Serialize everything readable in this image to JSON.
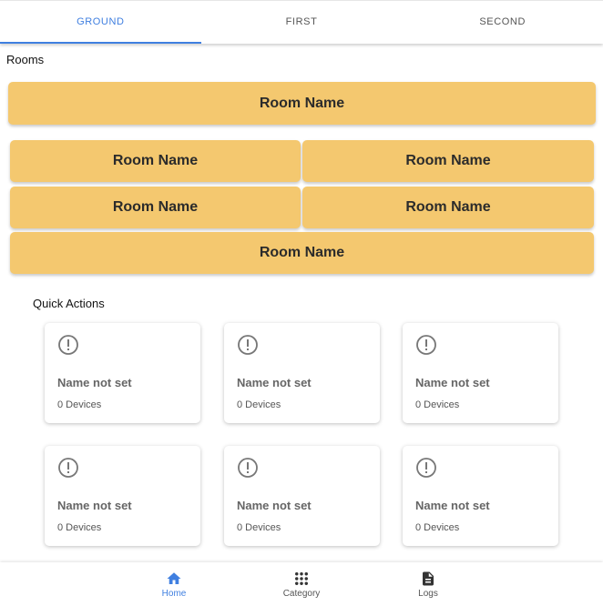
{
  "tabs": [
    {
      "label": "GROUND",
      "active": true
    },
    {
      "label": "FIRST",
      "active": false
    },
    {
      "label": "SECOND",
      "active": false
    }
  ],
  "rooms_section": {
    "label": "Rooms",
    "rooms": [
      "Room Name",
      "Room Name",
      "Room Name",
      "Room Name",
      "Room Name",
      "Room Name"
    ]
  },
  "quick_actions": {
    "label": "Quick Actions",
    "cards": [
      {
        "icon": "alert-circle-icon",
        "name": "Name not set",
        "devices": "0 Devices"
      },
      {
        "icon": "alert-circle-icon",
        "name": "Name not set",
        "devices": "0 Devices"
      },
      {
        "icon": "alert-circle-icon",
        "name": "Name not set",
        "devices": "0 Devices"
      },
      {
        "icon": "alert-circle-icon",
        "name": "Name not set",
        "devices": "0 Devices"
      },
      {
        "icon": "alert-circle-icon",
        "name": "Name not set",
        "devices": "0 Devices"
      },
      {
        "icon": "alert-circle-icon",
        "name": "Name not set",
        "devices": "0 Devices"
      }
    ]
  },
  "bottom_nav": [
    {
      "label": "Home",
      "icon": "home-icon",
      "active": true
    },
    {
      "label": "Category",
      "icon": "grid-icon",
      "active": false
    },
    {
      "label": "Logs",
      "icon": "document-icon",
      "active": false
    }
  ],
  "colors": {
    "accent": "#3f7fe0",
    "room_button": "#f4c86f"
  }
}
